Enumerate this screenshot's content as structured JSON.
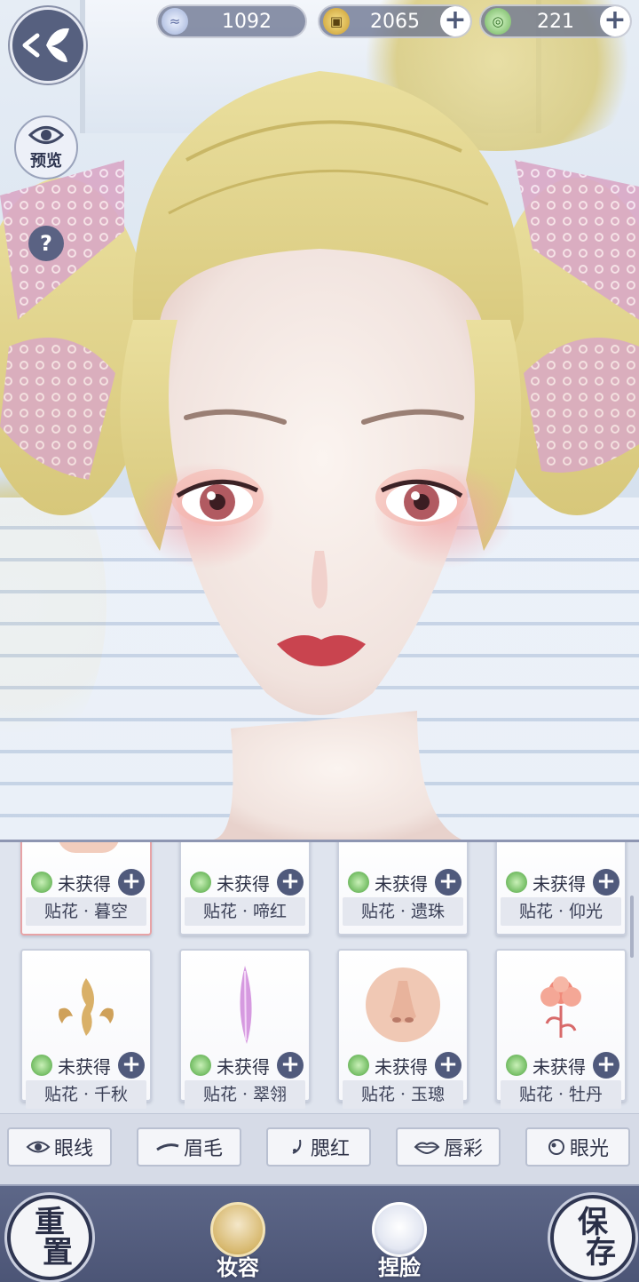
{
  "currencies": [
    {
      "icon": "silver-coin-icon",
      "value": "1092",
      "has_plus": false
    },
    {
      "icon": "copper-coin-icon",
      "value": "2065",
      "has_plus": true
    },
    {
      "icon": "jade-icon",
      "value": "221",
      "has_plus": true
    }
  ],
  "side": {
    "preview_label": "预览",
    "help_label": "?"
  },
  "status_label": "未获得",
  "cards_row1": [
    {
      "name": "贴花 · 暮空",
      "selected": true
    },
    {
      "name": "贴花 · 啼红",
      "selected": false
    },
    {
      "name": "贴花 · 遗珠",
      "selected": false
    },
    {
      "name": "贴花 · 仰光",
      "selected": false
    }
  ],
  "cards_row2": [
    {
      "name": "贴花 · 千秋",
      "thumb": "golden-flame-decal"
    },
    {
      "name": "贴花 · 翠翎",
      "thumb": "purple-feather-decal"
    },
    {
      "name": "贴花 · 玉璁",
      "thumb": "nose-preview"
    },
    {
      "name": "贴花 · 牡丹",
      "thumb": "peony-decal"
    }
  ],
  "tabs": [
    {
      "icon": "eye-icon",
      "label": "眼线"
    },
    {
      "icon": "brow-icon",
      "label": "眉毛"
    },
    {
      "icon": "blush-icon",
      "label": "腮红"
    },
    {
      "icon": "lips-icon",
      "label": "唇彩"
    },
    {
      "icon": "eye-light-icon",
      "label": "眼光"
    }
  ],
  "bottom": {
    "reset_line1": "重",
    "reset_line2": "置",
    "makeup_label": "妆容",
    "face_label": "捏脸",
    "save_line1": "保",
    "save_line2": "存"
  },
  "colors": {
    "panel_bg": "#dfe4ee",
    "bottom_bar": "#56607f",
    "selected_border": "#e7a3a6"
  }
}
